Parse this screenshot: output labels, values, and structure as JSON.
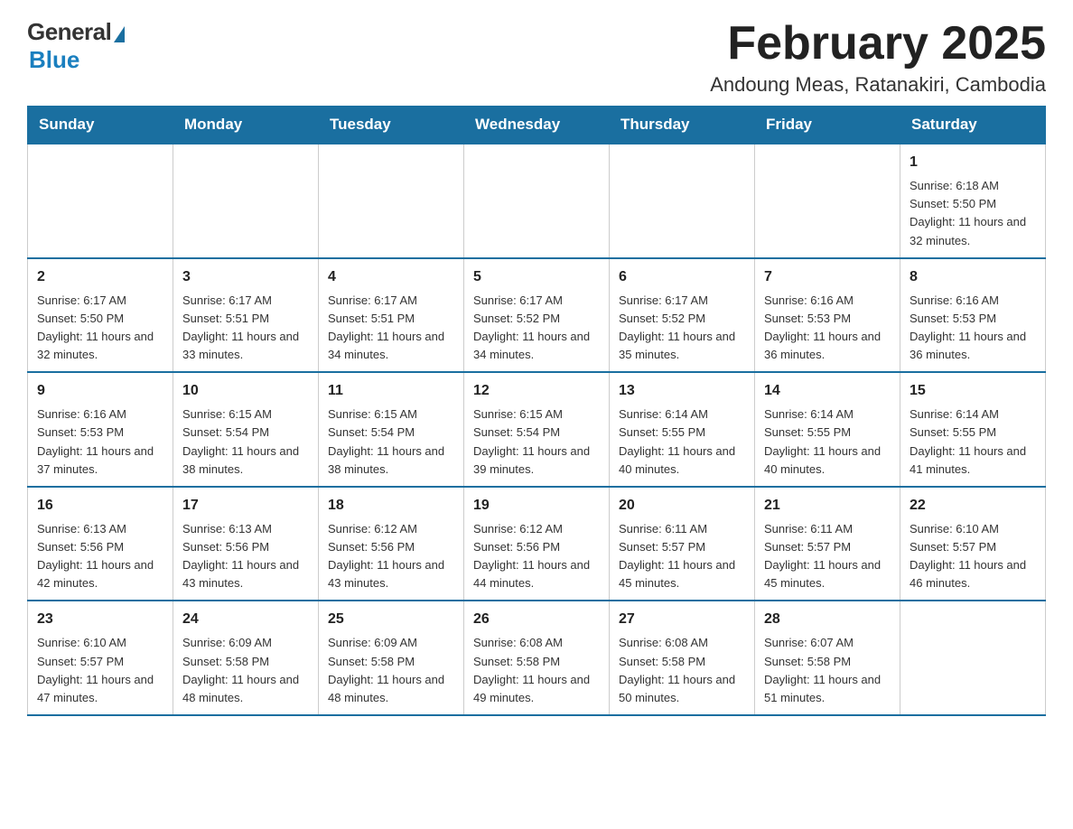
{
  "logo": {
    "general": "General",
    "blue": "Blue"
  },
  "title": {
    "month": "February 2025",
    "location": "Andoung Meas, Ratanakiri, Cambodia"
  },
  "weekdays": [
    "Sunday",
    "Monday",
    "Tuesday",
    "Wednesday",
    "Thursday",
    "Friday",
    "Saturday"
  ],
  "weeks": [
    [
      {
        "day": "",
        "info": ""
      },
      {
        "day": "",
        "info": ""
      },
      {
        "day": "",
        "info": ""
      },
      {
        "day": "",
        "info": ""
      },
      {
        "day": "",
        "info": ""
      },
      {
        "day": "",
        "info": ""
      },
      {
        "day": "1",
        "info": "Sunrise: 6:18 AM\nSunset: 5:50 PM\nDaylight: 11 hours and 32 minutes."
      }
    ],
    [
      {
        "day": "2",
        "info": "Sunrise: 6:17 AM\nSunset: 5:50 PM\nDaylight: 11 hours and 32 minutes."
      },
      {
        "day": "3",
        "info": "Sunrise: 6:17 AM\nSunset: 5:51 PM\nDaylight: 11 hours and 33 minutes."
      },
      {
        "day": "4",
        "info": "Sunrise: 6:17 AM\nSunset: 5:51 PM\nDaylight: 11 hours and 34 minutes."
      },
      {
        "day": "5",
        "info": "Sunrise: 6:17 AM\nSunset: 5:52 PM\nDaylight: 11 hours and 34 minutes."
      },
      {
        "day": "6",
        "info": "Sunrise: 6:17 AM\nSunset: 5:52 PM\nDaylight: 11 hours and 35 minutes."
      },
      {
        "day": "7",
        "info": "Sunrise: 6:16 AM\nSunset: 5:53 PM\nDaylight: 11 hours and 36 minutes."
      },
      {
        "day": "8",
        "info": "Sunrise: 6:16 AM\nSunset: 5:53 PM\nDaylight: 11 hours and 36 minutes."
      }
    ],
    [
      {
        "day": "9",
        "info": "Sunrise: 6:16 AM\nSunset: 5:53 PM\nDaylight: 11 hours and 37 minutes."
      },
      {
        "day": "10",
        "info": "Sunrise: 6:15 AM\nSunset: 5:54 PM\nDaylight: 11 hours and 38 minutes."
      },
      {
        "day": "11",
        "info": "Sunrise: 6:15 AM\nSunset: 5:54 PM\nDaylight: 11 hours and 38 minutes."
      },
      {
        "day": "12",
        "info": "Sunrise: 6:15 AM\nSunset: 5:54 PM\nDaylight: 11 hours and 39 minutes."
      },
      {
        "day": "13",
        "info": "Sunrise: 6:14 AM\nSunset: 5:55 PM\nDaylight: 11 hours and 40 minutes."
      },
      {
        "day": "14",
        "info": "Sunrise: 6:14 AM\nSunset: 5:55 PM\nDaylight: 11 hours and 40 minutes."
      },
      {
        "day": "15",
        "info": "Sunrise: 6:14 AM\nSunset: 5:55 PM\nDaylight: 11 hours and 41 minutes."
      }
    ],
    [
      {
        "day": "16",
        "info": "Sunrise: 6:13 AM\nSunset: 5:56 PM\nDaylight: 11 hours and 42 minutes."
      },
      {
        "day": "17",
        "info": "Sunrise: 6:13 AM\nSunset: 5:56 PM\nDaylight: 11 hours and 43 minutes."
      },
      {
        "day": "18",
        "info": "Sunrise: 6:12 AM\nSunset: 5:56 PM\nDaylight: 11 hours and 43 minutes."
      },
      {
        "day": "19",
        "info": "Sunrise: 6:12 AM\nSunset: 5:56 PM\nDaylight: 11 hours and 44 minutes."
      },
      {
        "day": "20",
        "info": "Sunrise: 6:11 AM\nSunset: 5:57 PM\nDaylight: 11 hours and 45 minutes."
      },
      {
        "day": "21",
        "info": "Sunrise: 6:11 AM\nSunset: 5:57 PM\nDaylight: 11 hours and 45 minutes."
      },
      {
        "day": "22",
        "info": "Sunrise: 6:10 AM\nSunset: 5:57 PM\nDaylight: 11 hours and 46 minutes."
      }
    ],
    [
      {
        "day": "23",
        "info": "Sunrise: 6:10 AM\nSunset: 5:57 PM\nDaylight: 11 hours and 47 minutes."
      },
      {
        "day": "24",
        "info": "Sunrise: 6:09 AM\nSunset: 5:58 PM\nDaylight: 11 hours and 48 minutes."
      },
      {
        "day": "25",
        "info": "Sunrise: 6:09 AM\nSunset: 5:58 PM\nDaylight: 11 hours and 48 minutes."
      },
      {
        "day": "26",
        "info": "Sunrise: 6:08 AM\nSunset: 5:58 PM\nDaylight: 11 hours and 49 minutes."
      },
      {
        "day": "27",
        "info": "Sunrise: 6:08 AM\nSunset: 5:58 PM\nDaylight: 11 hours and 50 minutes."
      },
      {
        "day": "28",
        "info": "Sunrise: 6:07 AM\nSunset: 5:58 PM\nDaylight: 11 hours and 51 minutes."
      },
      {
        "day": "",
        "info": ""
      }
    ]
  ]
}
